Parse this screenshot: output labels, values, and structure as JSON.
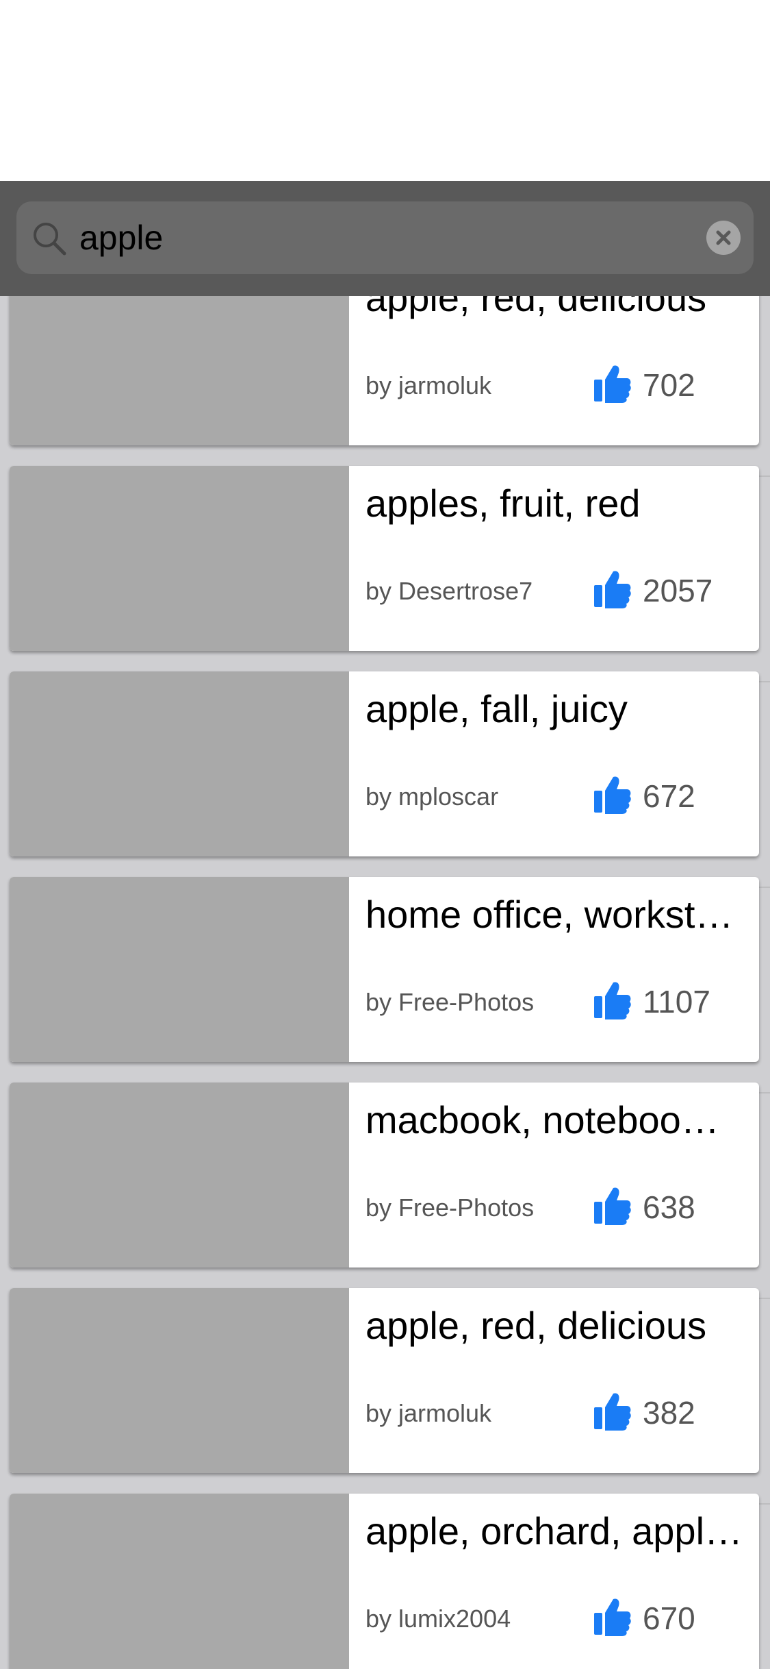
{
  "search": {
    "value": "apple",
    "placeholder": ""
  },
  "colors": {
    "accent": "#1a7cf5",
    "search_bar": "#595959",
    "list_background": "#cfcfd2",
    "image_placeholder": "#a9a9a9"
  },
  "results": [
    {
      "title": "apple, red, delicious",
      "author": "by jarmoluk",
      "likes": "702"
    },
    {
      "title": "apples, fruit, red",
      "author": "by Desertrose7",
      "likes": "2057"
    },
    {
      "title": "apple, fall, juicy",
      "author": "by mploscar",
      "likes": "672"
    },
    {
      "title": "home office, workst…",
      "author": "by Free-Photos",
      "likes": "1107"
    },
    {
      "title": "macbook, noteboo…",
      "author": "by Free-Photos",
      "likes": "638"
    },
    {
      "title": "apple, red, delicious",
      "author": "by jarmoluk",
      "likes": "382"
    },
    {
      "title": "apple, orchard, appl…",
      "author": "by lumix2004",
      "likes": "670"
    }
  ]
}
